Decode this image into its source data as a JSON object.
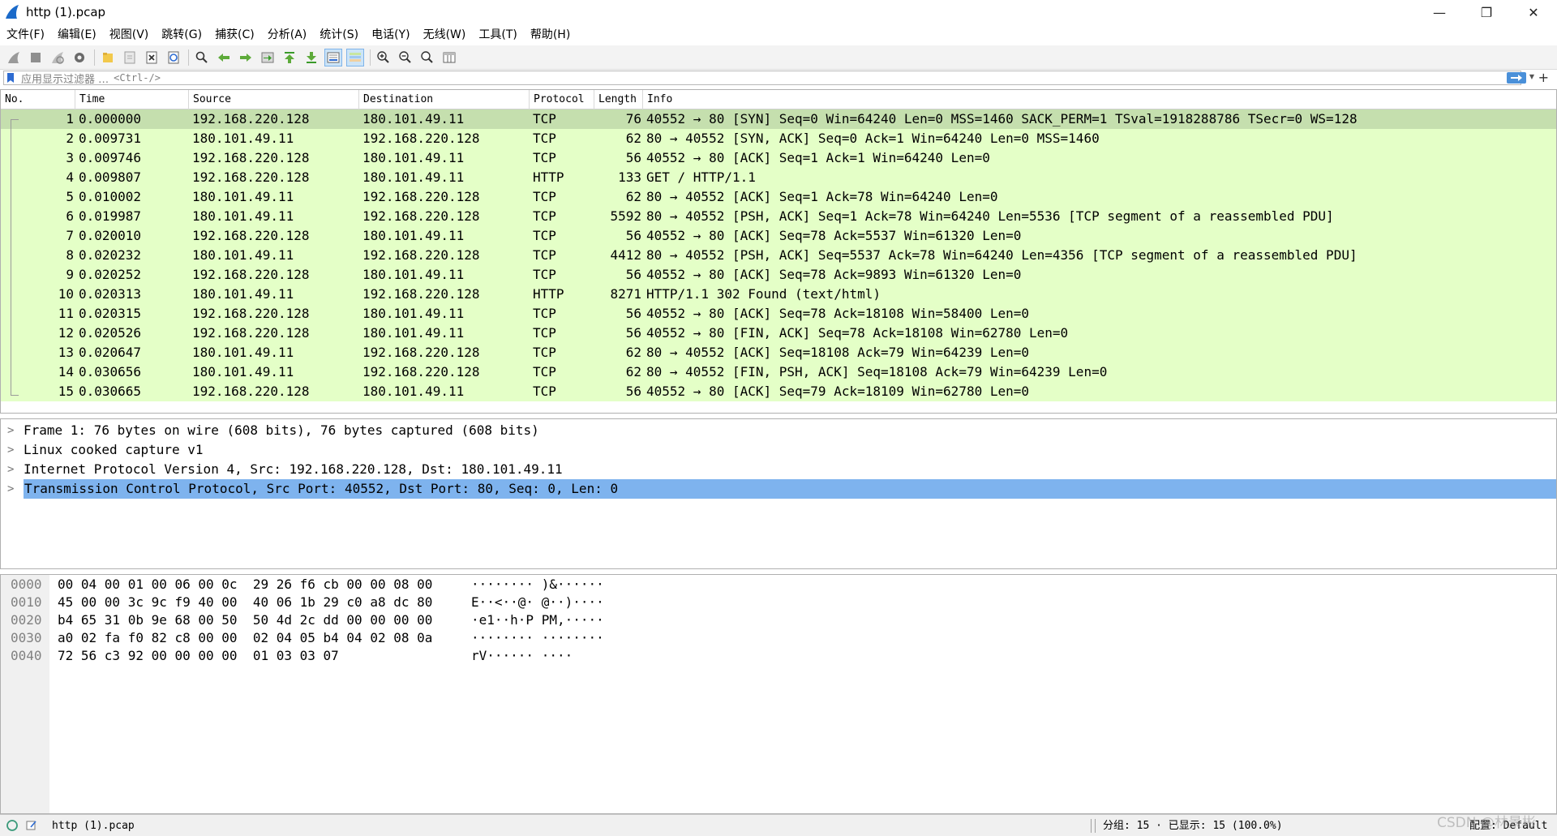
{
  "window": {
    "title": "http (1).pcap",
    "minimize": "—",
    "restore": "❐",
    "close": "✕"
  },
  "menu": [
    "文件(F)",
    "编辑(E)",
    "视图(V)",
    "跳转(G)",
    "捕获(C)",
    "分析(A)",
    "统计(S)",
    "电话(Y)",
    "无线(W)",
    "工具(T)",
    "帮助(H)"
  ],
  "toolbar": {
    "icons": [
      "shark-fin-icon",
      "stop-icon",
      "restart-icon",
      "options-gear-icon",
      "open-folder-icon",
      "save-file-icon",
      "close-file-icon",
      "reload-icon",
      "find-icon",
      "go-back-icon",
      "go-forward-icon",
      "go-to-packet-icon",
      "go-first-icon",
      "go-last-icon",
      "autoscroll-icon",
      "colorize-icon",
      "zoom-in-icon",
      "zoom-out-icon",
      "zoom-reset-icon",
      "resize-columns-icon"
    ]
  },
  "filter": {
    "placeholder": "应用显示过滤器 …",
    "shortcut": "<Ctrl-/>",
    "plus": "+"
  },
  "packet_list": {
    "columns": [
      "No.",
      "Time",
      "Source",
      "Destination",
      "Protocol",
      "Length",
      "Info"
    ],
    "rows": [
      {
        "no": "1",
        "time": "0.000000",
        "src": "192.168.220.128",
        "dst": "180.101.49.11",
        "proto": "TCP",
        "len": "76",
        "info": "40552 → 80 [SYN] Seq=0 Win=64240 Len=0 MSS=1460 SACK_PERM=1 TSval=1918288786 TSecr=0 WS=128"
      },
      {
        "no": "2",
        "time": "0.009731",
        "src": "180.101.49.11",
        "dst": "192.168.220.128",
        "proto": "TCP",
        "len": "62",
        "info": "80 → 40552 [SYN, ACK] Seq=0 Ack=1 Win=64240 Len=0 MSS=1460"
      },
      {
        "no": "3",
        "time": "0.009746",
        "src": "192.168.220.128",
        "dst": "180.101.49.11",
        "proto": "TCP",
        "len": "56",
        "info": "40552 → 80 [ACK] Seq=1 Ack=1 Win=64240 Len=0"
      },
      {
        "no": "4",
        "time": "0.009807",
        "src": "192.168.220.128",
        "dst": "180.101.49.11",
        "proto": "HTTP",
        "len": "133",
        "info": "GET / HTTP/1.1"
      },
      {
        "no": "5",
        "time": "0.010002",
        "src": "180.101.49.11",
        "dst": "192.168.220.128",
        "proto": "TCP",
        "len": "62",
        "info": "80 → 40552 [ACK] Seq=1 Ack=78 Win=64240 Len=0"
      },
      {
        "no": "6",
        "time": "0.019987",
        "src": "180.101.49.11",
        "dst": "192.168.220.128",
        "proto": "TCP",
        "len": "5592",
        "info": "80 → 40552 [PSH, ACK] Seq=1 Ack=78 Win=64240 Len=5536 [TCP segment of a reassembled PDU]"
      },
      {
        "no": "7",
        "time": "0.020010",
        "src": "192.168.220.128",
        "dst": "180.101.49.11",
        "proto": "TCP",
        "len": "56",
        "info": "40552 → 80 [ACK] Seq=78 Ack=5537 Win=61320 Len=0"
      },
      {
        "no": "8",
        "time": "0.020232",
        "src": "180.101.49.11",
        "dst": "192.168.220.128",
        "proto": "TCP",
        "len": "4412",
        "info": "80 → 40552 [PSH, ACK] Seq=5537 Ack=78 Win=64240 Len=4356 [TCP segment of a reassembled PDU]"
      },
      {
        "no": "9",
        "time": "0.020252",
        "src": "192.168.220.128",
        "dst": "180.101.49.11",
        "proto": "TCP",
        "len": "56",
        "info": "40552 → 80 [ACK] Seq=78 Ack=9893 Win=61320 Len=0"
      },
      {
        "no": "10",
        "time": "0.020313",
        "src": "180.101.49.11",
        "dst": "192.168.220.128",
        "proto": "HTTP",
        "len": "8271",
        "info": "HTTP/1.1 302 Found  (text/html)"
      },
      {
        "no": "11",
        "time": "0.020315",
        "src": "192.168.220.128",
        "dst": "180.101.49.11",
        "proto": "TCP",
        "len": "56",
        "info": "40552 → 80 [ACK] Seq=78 Ack=18108 Win=58400 Len=0"
      },
      {
        "no": "12",
        "time": "0.020526",
        "src": "192.168.220.128",
        "dst": "180.101.49.11",
        "proto": "TCP",
        "len": "56",
        "info": "40552 → 80 [FIN, ACK] Seq=78 Ack=18108 Win=62780 Len=0"
      },
      {
        "no": "13",
        "time": "0.020647",
        "src": "180.101.49.11",
        "dst": "192.168.220.128",
        "proto": "TCP",
        "len": "62",
        "info": "80 → 40552 [ACK] Seq=18108 Ack=79 Win=64239 Len=0"
      },
      {
        "no": "14",
        "time": "0.030656",
        "src": "180.101.49.11",
        "dst": "192.168.220.128",
        "proto": "TCP",
        "len": "62",
        "info": "80 → 40552 [FIN, PSH, ACK] Seq=18108 Ack=79 Win=64239 Len=0"
      },
      {
        "no": "15",
        "time": "0.030665",
        "src": "192.168.220.128",
        "dst": "180.101.49.11",
        "proto": "TCP",
        "len": "56",
        "info": "40552 → 80 [ACK] Seq=79 Ack=18109 Win=62780 Len=0"
      }
    ]
  },
  "details": [
    "Frame 1: 76 bytes on wire (608 bits), 76 bytes captured (608 bits)",
    "Linux cooked capture v1",
    "Internet Protocol Version 4, Src: 192.168.220.128, Dst: 180.101.49.11",
    "Transmission Control Protocol, Src Port: 40552, Dst Port: 80, Seq: 0, Len: 0"
  ],
  "bytes": [
    {
      "offset": "0000",
      "hex": "00 04 00 01 00 06 00 0c  29 26 f6 cb 00 00 08 00",
      "ascii": "········ )&······"
    },
    {
      "offset": "0010",
      "hex": "45 00 00 3c 9c f9 40 00  40 06 1b 29 c0 a8 dc 80",
      "ascii": "E··<··@· @··)····"
    },
    {
      "offset": "0020",
      "hex": "b4 65 31 0b 9e 68 00 50  50 4d 2c dd 00 00 00 00",
      "ascii": "·e1··h·P PM,·····"
    },
    {
      "offset": "0030",
      "hex": "a0 02 fa f0 82 c8 00 00  02 04 05 b4 04 02 08 0a",
      "ascii": "········ ········"
    },
    {
      "offset": "0040",
      "hex": "72 56 c3 92 00 00 00 00  01 03 03 07",
      "ascii": "rV······ ····"
    }
  ],
  "status": {
    "file": "http (1).pcap",
    "stats": "分组: 15 · 已显示: 15 (100.0%)",
    "profile": "配置: Default",
    "watermark": "CSDN @林景彬"
  },
  "colors": {
    "row_bg": "#e4ffc7",
    "row_selected": "#c5dfae",
    "detail_selected": "#7eb3ee"
  }
}
